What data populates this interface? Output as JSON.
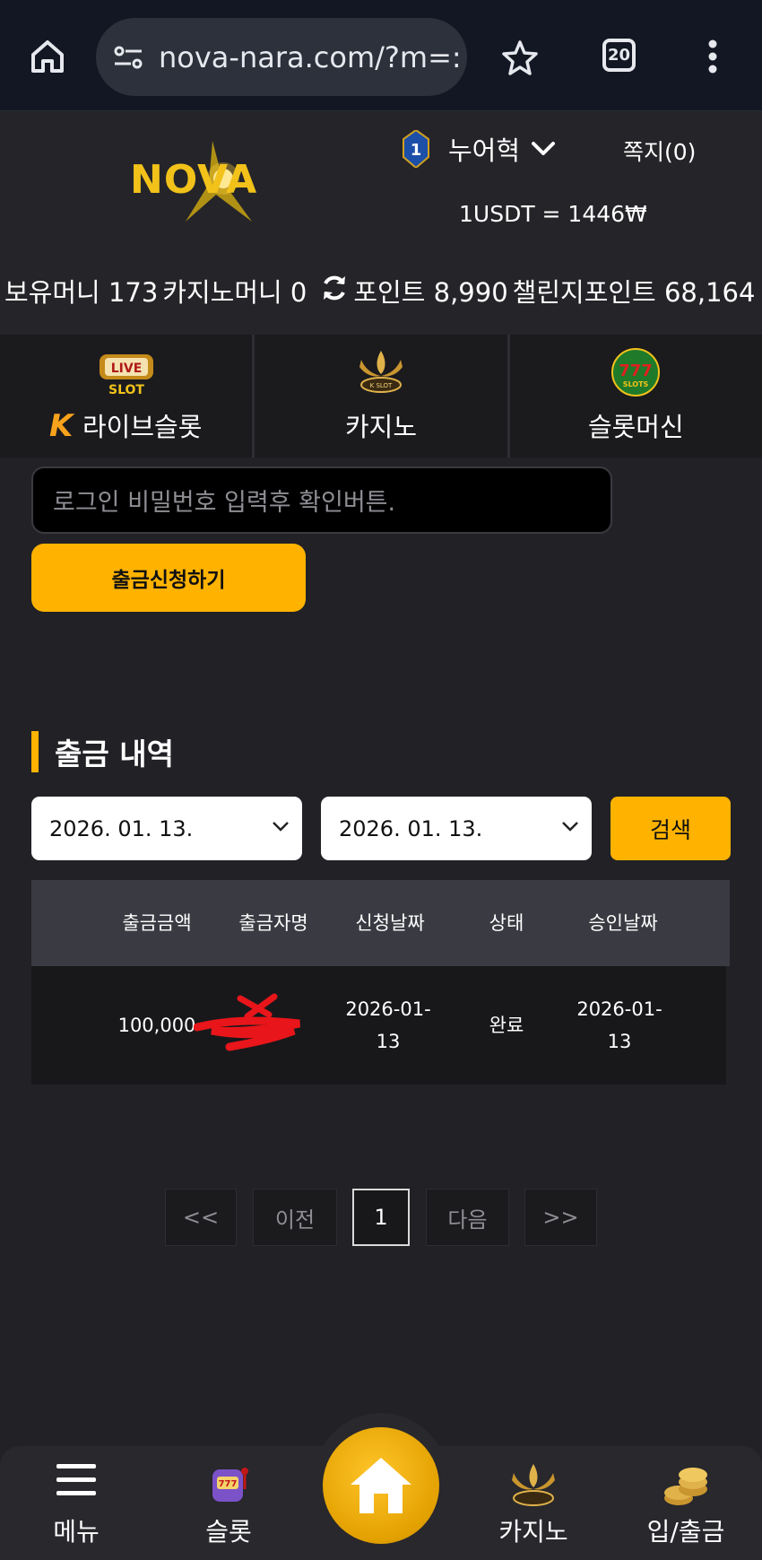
{
  "browser": {
    "url": "nova-nara.com/?m=:",
    "tab_count": "20"
  },
  "header": {
    "logo_text": "NOVA",
    "username": "누어혁",
    "messages": "쪽지(0)",
    "rate": "1USDT = 1446₩"
  },
  "balances": {
    "money": "보유머니 173",
    "casino_money": "카지노머니 0",
    "points": "포인트 8,990",
    "challenge_points": "챌린지포인트 68,164"
  },
  "categories": [
    {
      "label": "라이브슬롯",
      "icon": "live-slot-icon"
    },
    {
      "label": "카지노",
      "icon": "k-slot-icon"
    },
    {
      "label": "슬롯머신",
      "icon": "777-slots-icon"
    }
  ],
  "form": {
    "password_placeholder": "로그인 비밀번호 입력후 확인버튼.",
    "submit_label": "출금신청하기"
  },
  "history": {
    "title": "출금 내역",
    "date_from": "2026. 01. 13.",
    "date_to": "2026. 01. 13.",
    "search_label": "검색",
    "columns": [
      "출금금액",
      "출금자명",
      "신청날짜",
      "상태",
      "승인날짜"
    ],
    "rows": [
      {
        "amount": "100,000",
        "name": "",
        "requested": "2026-01-13",
        "status": "완료",
        "approved": "2026-01-13"
      }
    ]
  },
  "pagination": {
    "first": "<<",
    "prev": "이전",
    "current": "1",
    "next": "다음",
    "last": ">>"
  },
  "bottom_nav": {
    "menu": "메뉴",
    "slot": "슬롯",
    "casino": "카지노",
    "deposit_withdraw": "입/출금"
  },
  "colors": {
    "accent": "#ffb300",
    "background": "#212126",
    "table_header": "#3a3b42"
  }
}
